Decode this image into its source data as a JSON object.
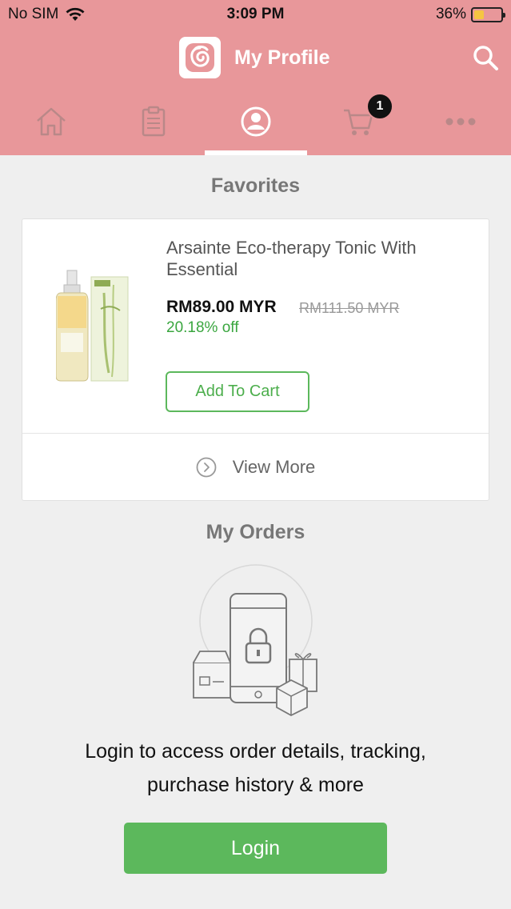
{
  "status_bar": {
    "carrier": "No SIM",
    "time": "3:09 PM",
    "battery_percent": "36%",
    "battery_level": 0.36
  },
  "header": {
    "title": "My Profile",
    "bg_color": "#e8979a"
  },
  "tabs": [
    {
      "name": "home",
      "icon": "home-icon",
      "active": false
    },
    {
      "name": "orders",
      "icon": "clipboard-icon",
      "active": false
    },
    {
      "name": "profile",
      "icon": "profile-icon",
      "active": true
    },
    {
      "name": "cart",
      "icon": "cart-icon",
      "active": false,
      "badge": "1"
    },
    {
      "name": "more",
      "icon": "more-icon",
      "active": false
    }
  ],
  "favorites": {
    "title": "Favorites",
    "product": {
      "name": "Arsainte Eco-therapy Tonic With Essential",
      "price": "RM89.00 MYR",
      "old_price": "RM111.50 MYR",
      "discount": "20.18% off",
      "add_to_cart_label": "Add To Cart"
    },
    "view_more_label": "View More"
  },
  "orders": {
    "title": "My Orders",
    "message_line1": "Login to access order details, tracking,",
    "message_line2": "purchase history & more",
    "login_label": "Login"
  },
  "colors": {
    "accent_green": "#5cb85c",
    "header_pink": "#e8979a"
  }
}
